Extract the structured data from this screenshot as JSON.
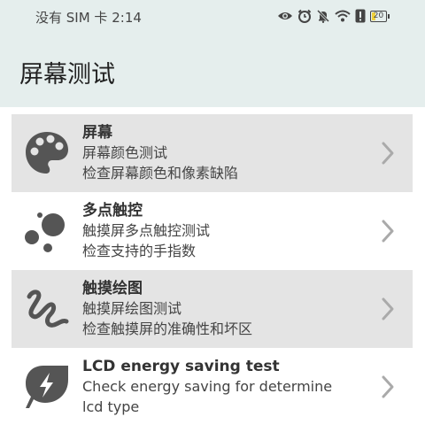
{
  "status_bar": {
    "carrier": "没有 SIM 卡",
    "time": "2:14",
    "battery": "20"
  },
  "header": {
    "title": "屏幕测试"
  },
  "items": [
    {
      "title": "屏幕",
      "subtitle": "屏幕颜色测试",
      "detail": "检查屏幕颜色和像素缺陷",
      "icon": "palette-icon"
    },
    {
      "title": "多点触控",
      "subtitle": "触摸屏多点触控测试",
      "detail": "检查支持的手指数",
      "icon": "multi-dot-icon"
    },
    {
      "title": "触摸绘图",
      "subtitle": "触摸屏绘图测试",
      "detail": "检查触摸屏的准确性和坏区",
      "icon": "squiggle-icon"
    },
    {
      "title": "LCD energy saving test",
      "subtitle": "Check energy saving for determine",
      "detail": "lcd type",
      "icon": "energy-leaf-icon"
    }
  ]
}
